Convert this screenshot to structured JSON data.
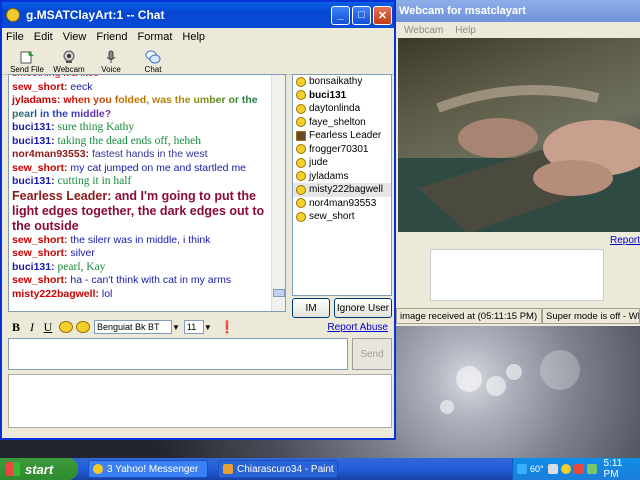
{
  "chat_window": {
    "title": "g.MSATClayArt:1 -- Chat",
    "menu": [
      "File",
      "Edit",
      "View",
      "Friend",
      "Format",
      "Help"
    ],
    "toolbar": [
      "Send File",
      "Webcam",
      "Voice",
      "Chat"
    ],
    "messages": [
      {
        "name": "",
        "text": "smoothing it a little",
        "color": "#cc0000"
      },
      {
        "name": "sew_short:",
        "text": "eeck",
        "color": "#cc0000",
        "textcolor": "#1a1aaa"
      },
      {
        "name": "jyladams:",
        "text": "when you folded, was the umber or the pearl in the middle?",
        "color": "#cc0000",
        "textcolor": "multi"
      },
      {
        "name": "buci131:",
        "text": "sure thing Kathy",
        "color": "#1a1aaa",
        "textcolor": "#168a3a"
      },
      {
        "name": "buci131:",
        "text": "taking the dead ends off, heheh",
        "color": "#1a1aaa",
        "textcolor": "#168a3a"
      },
      {
        "name": "nor4man93553:",
        "text": "fastest hands in the west",
        "color": "#8b1a1a",
        "textcolor": "#333399"
      },
      {
        "name": "sew_short:",
        "text": "my cat jumped on me and startled me",
        "color": "#cc0000",
        "textcolor": "#1a1aaa"
      },
      {
        "name": "buci131:",
        "text": "cutting it in half",
        "color": "#1a1aaa",
        "textcolor": "#168a3a"
      },
      {
        "name": "Fearless Leader:",
        "text": "and I'm going to put the light edges together, the dark edges out to the outside",
        "color": "#8b1a1a",
        "textcolor": "#8b0a3a"
      },
      {
        "name": "sew_short:",
        "text": "the silerr was in middle, i think",
        "color": "#cc0000",
        "textcolor": "#1a1aaa"
      },
      {
        "name": "sew_short:",
        "text": "silver",
        "color": "#cc0000",
        "textcolor": "#1a1aaa"
      },
      {
        "name": "buci131:",
        "text": "pearl, Kay",
        "color": "#1a1aaa",
        "textcolor": "#168a3a"
      },
      {
        "name": "sew_short:",
        "text": "ha - can't think with cat in my arms",
        "color": "#cc0000",
        "textcolor": "#1a1aaa"
      },
      {
        "name": "misty222bagwell:",
        "text": "lol",
        "color": "#cc0000",
        "textcolor": "#1a1aaa"
      }
    ],
    "users": [
      "bonsaikathy",
      "buci131",
      "daytonlinda",
      "faye_shelton",
      "Fearless Leader",
      "frogger70301",
      "jude",
      "jyladams",
      "misty222bagwell",
      "nor4man93553",
      "sew_short"
    ],
    "im_button": "IM",
    "ignore_button": "Ignore User",
    "format": {
      "bold": "B",
      "italic": "I",
      "underline": "U",
      "font": "Benguiat Bk BT",
      "size": "11"
    },
    "report_abuse": "Report Abuse",
    "send_button": "Send"
  },
  "webcam_window": {
    "title": "Webcam for msatclayart",
    "menu": [
      "Webcam",
      "Help"
    ],
    "report": "Report",
    "status_left": "image received at (05:11:15 PM)",
    "status_right": "Super mode is off - What"
  },
  "taskbar": {
    "start": "start",
    "tasks": [
      "3 Yahoo! Messenger",
      "Chiarascuro34 - Paint"
    ],
    "temperature": "60°",
    "clock": "5:11 PM"
  }
}
